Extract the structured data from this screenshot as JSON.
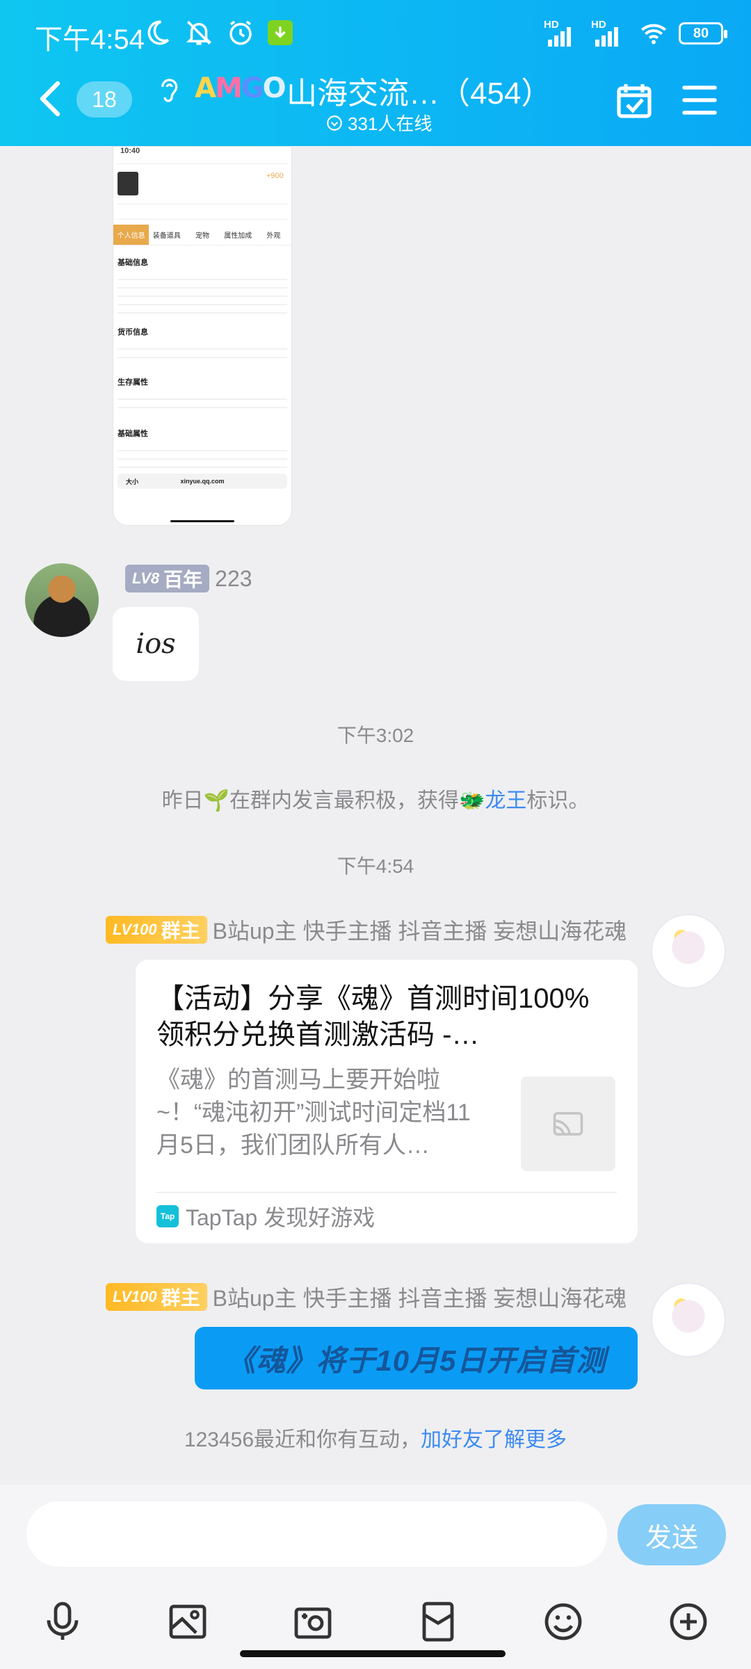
{
  "status_bar": {
    "time": "下午4:54",
    "hd1": "HD",
    "hd2": "HD",
    "battery": "80"
  },
  "header": {
    "unread_count": "18",
    "logo_text": [
      "A",
      "M",
      "G",
      "O"
    ],
    "group_title": "山海交流…（454）",
    "online_count": "331人在线",
    "accent_color": "#0aa9f5"
  },
  "screenshot_card": {
    "time": "10:40",
    "money": "+900",
    "tabs": [
      "个人信息",
      "装备道具",
      "宠物",
      "属性加成",
      "外观"
    ],
    "sections": [
      "基础信息",
      "货币信息",
      "生存属性",
      "基础属性"
    ],
    "url": "xinyue.qq.com",
    "url_prefix": "大小"
  },
  "messages": [
    {
      "sender_level": "LV8",
      "sender_title": "百年",
      "sender_name": "223",
      "text": "ios"
    }
  ],
  "system": {
    "time1": "下午3:02",
    "notice_prefix": "昨日🌱在群内发言最积极，获得🐲",
    "notice_highlight": "龙王",
    "notice_suffix": "标识。",
    "time2": "下午4:54"
  },
  "owner_messages": {
    "level": "LV100",
    "title": "群主",
    "name": "B站up主 快手主播 抖音主播 妄想山海花魂",
    "share": {
      "title": "【活动】分享《魂》首测时间100%领积分兑换首测激活码 -…",
      "desc": "《魂》的首测马上要开始啦~！“魂沌初开”测试时间定档11月5日，我们团队所有人…",
      "source": "TapTap 发现好游戏",
      "source_logo": "Tap"
    },
    "bubble_text": "《魂》将于10月5日开启首测"
  },
  "hint": {
    "prefix": "123456最近和你有互动，",
    "link": "加好友了解更多"
  },
  "input": {
    "placeholder": "",
    "send_label": "发送"
  },
  "toolbar_icons": [
    "mic-icon",
    "image-icon",
    "camera-icon",
    "red-packet-icon",
    "emoji-icon",
    "plus-icon"
  ]
}
